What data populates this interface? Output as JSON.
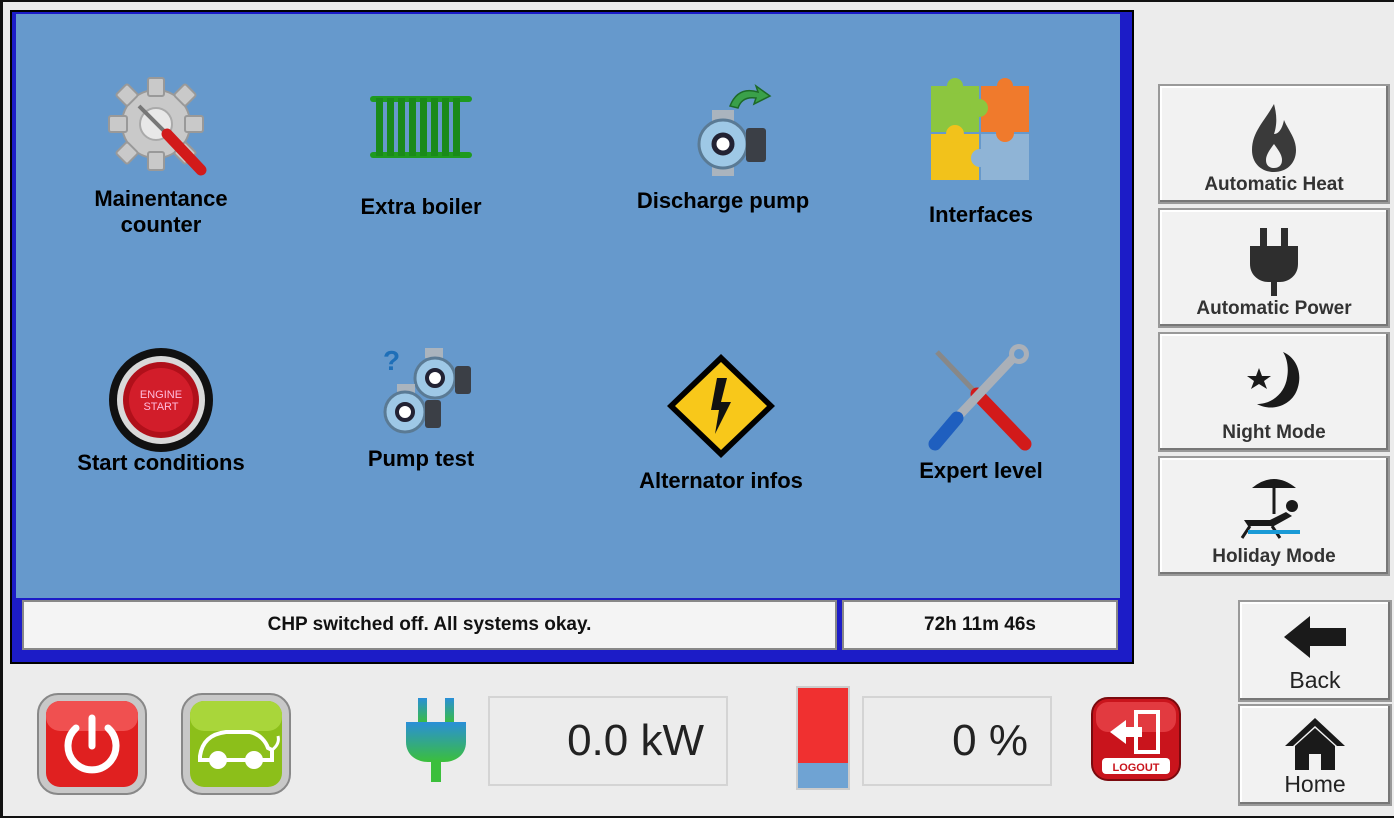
{
  "tiles": [
    {
      "label_line1": "Mainentance",
      "label_line2": "counter",
      "icon": "gear-wrench-icon"
    },
    {
      "label": "Extra boiler",
      "icon": "radiator-icon"
    },
    {
      "label": "Discharge pump",
      "icon": "pump-arrow-icon"
    },
    {
      "label": "Interfaces",
      "icon": "puzzle-icon"
    },
    {
      "label": "Start conditions",
      "icon": "engine-start-icon"
    },
    {
      "label": "Pump test",
      "icon": "pump-question-icon"
    },
    {
      "label": "Alternator infos",
      "icon": "high-voltage-icon"
    },
    {
      "label": "Expert level",
      "icon": "tools-icon"
    }
  ],
  "engine_button_text": {
    "line1": "ENGINE",
    "line2": "START"
  },
  "status": {
    "message": "CHP switched off. All systems okay.",
    "runtime": "72h 11m 46s"
  },
  "modes": [
    {
      "label": "Automatic Heat",
      "icon": "flame-icon"
    },
    {
      "label": "Automatic Power",
      "icon": "plug-icon"
    },
    {
      "label": "Night Mode",
      "icon": "moon-star-icon"
    },
    {
      "label": "Holiday Mode",
      "icon": "beach-chair-icon"
    }
  ],
  "nav": {
    "back": "Back",
    "home": "Home"
  },
  "readouts": {
    "power": "0.0 kW",
    "storage": "0 %",
    "storage_fill_fraction": 0.75
  },
  "logout_label": "LOGOUT",
  "colors": {
    "panel_blue": "#6699cc",
    "frame_blue": "#1c1cc7",
    "power_red": "#e02020",
    "eco_green": "#8cbf1a"
  }
}
